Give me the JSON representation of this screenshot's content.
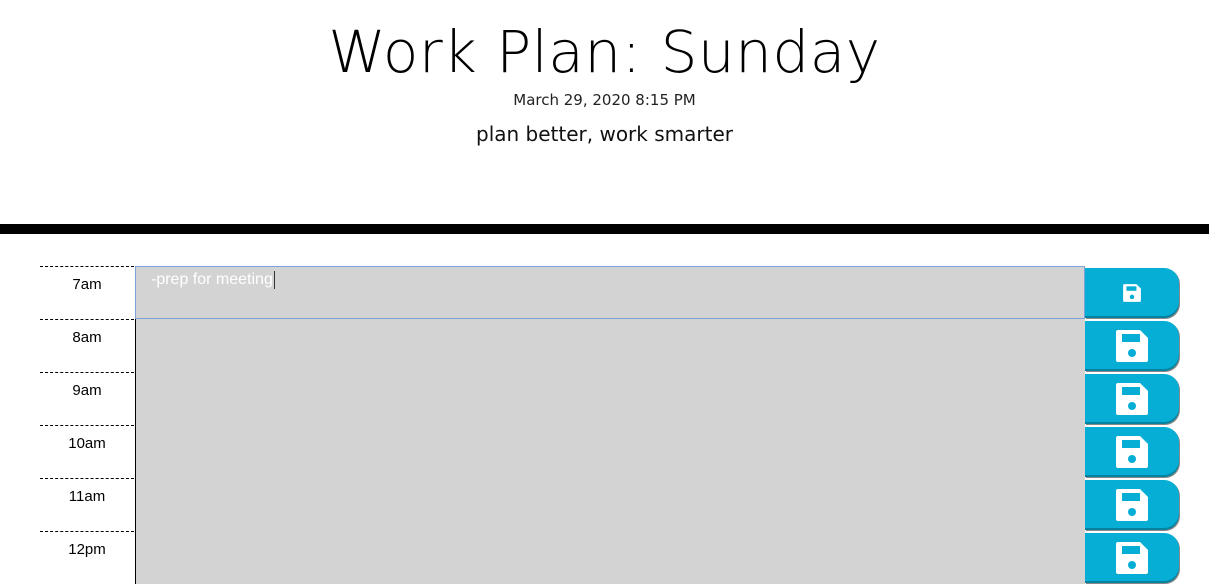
{
  "header": {
    "title": "Work Plan: Sunday",
    "datetime": "March 29, 2020 8:15 PM",
    "tagline": "plan better, work smarter"
  },
  "rows": [
    {
      "hour": "7am",
      "text": "-prep for meeting",
      "active": true
    },
    {
      "hour": "8am",
      "text": ""
    },
    {
      "hour": "9am",
      "text": ""
    },
    {
      "hour": "10am",
      "text": ""
    },
    {
      "hour": "11am",
      "text": ""
    },
    {
      "hour": "12pm",
      "text": ""
    }
  ],
  "icons": {
    "save": "floppy-disk-icon"
  },
  "colors": {
    "save_button": "#06aed5",
    "past_row": "#d3d3d3",
    "divider": "#000000"
  }
}
